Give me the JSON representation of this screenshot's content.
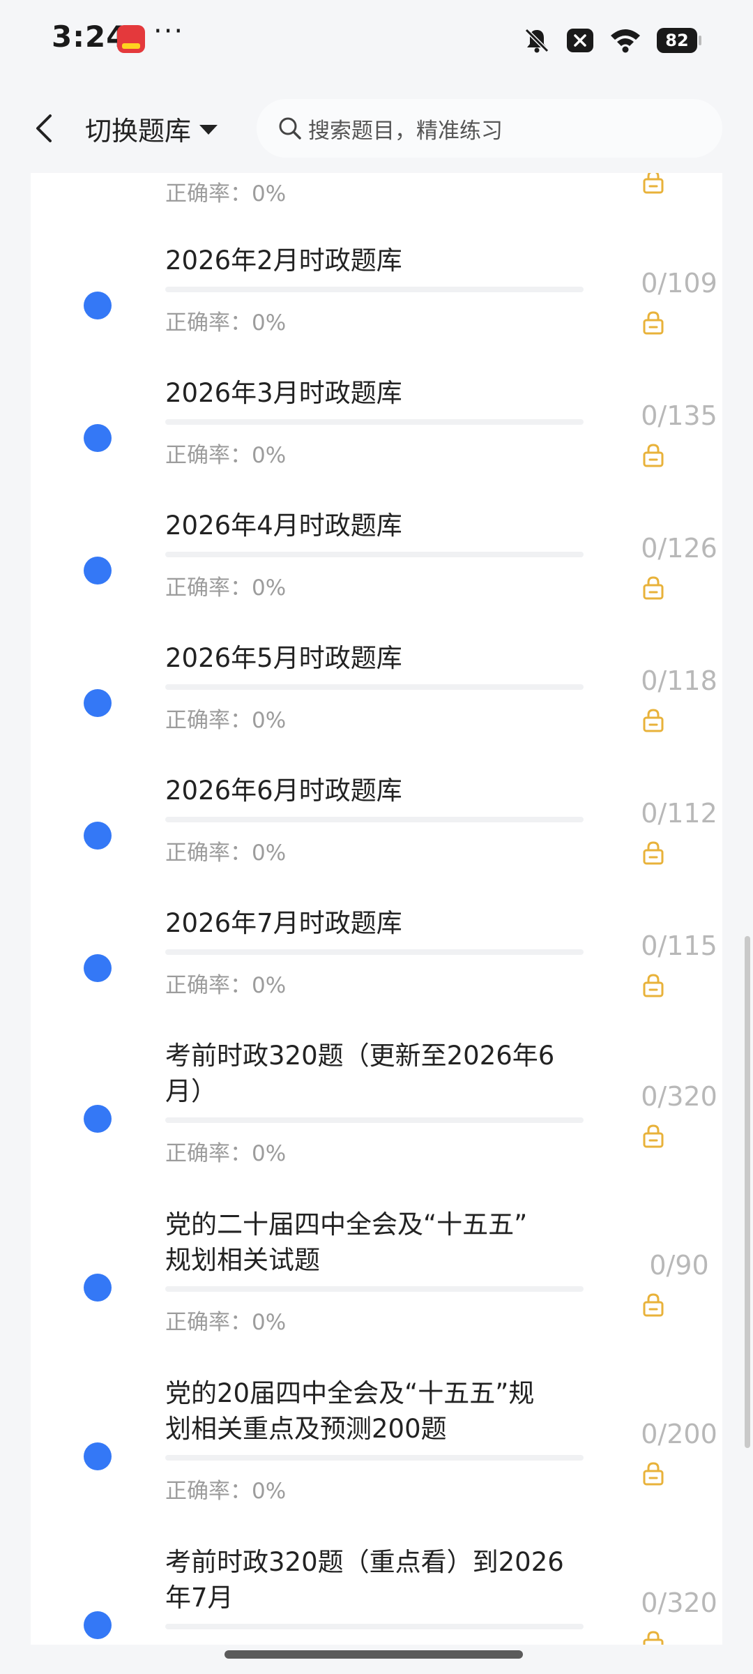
{
  "status_bar": {
    "time": "3:24",
    "more": "···",
    "battery": "82",
    "icons": [
      "app-618-icon",
      "mute-bell-icon",
      "close-box-icon",
      "wifi-icon",
      "battery-icon"
    ]
  },
  "header": {
    "switch_label": "切换题库",
    "search_placeholder": "搜索题目，精准练习",
    "icons": [
      "back-icon",
      "caret-down-icon",
      "search-icon"
    ]
  },
  "accent_color": "#3478f6",
  "lock_color": "#e8b23a",
  "list": {
    "partial_top_accuracy": "正确率：0%",
    "items": [
      {
        "title_lines": [
          "2026年2月时政题库"
        ],
        "accuracy": "正确率：0%",
        "count": "0/109",
        "progress": 0
      },
      {
        "title_lines": [
          "2026年3月时政题库"
        ],
        "accuracy": "正确率：0%",
        "count": "0/135",
        "progress": 0
      },
      {
        "title_lines": [
          "2026年4月时政题库"
        ],
        "accuracy": "正确率：0%",
        "count": "0/126",
        "progress": 0
      },
      {
        "title_lines": [
          "2026年5月时政题库"
        ],
        "accuracy": "正确率：0%",
        "count": "0/118",
        "progress": 0
      },
      {
        "title_lines": [
          "2026年6月时政题库"
        ],
        "accuracy": "正确率：0%",
        "count": "0/112",
        "progress": 0
      },
      {
        "title_lines": [
          "2026年7月时政题库"
        ],
        "accuracy": "正确率：0%",
        "count": "0/115",
        "progress": 0
      },
      {
        "title_lines": [
          "考前时政320题（更新至2026年6",
          "月）"
        ],
        "accuracy": "正确率：0%",
        "count": "0/320",
        "progress": 0
      },
      {
        "title_lines": [
          "党的二十届四中全会及“十五五”",
          "规划相关试题"
        ],
        "accuracy": "正确率：0%",
        "count": "0/90",
        "progress": 0
      },
      {
        "title_lines": [
          "党的20届四中全会及“十五五”规",
          "划相关重点及预测200题"
        ],
        "accuracy": "正确率：0%",
        "count": "0/200",
        "progress": 0
      },
      {
        "title_lines": [
          "考前时政320题（重点看）到2026",
          "年7月"
        ],
        "accuracy": "",
        "count": "0/320",
        "progress": 0
      }
    ]
  }
}
